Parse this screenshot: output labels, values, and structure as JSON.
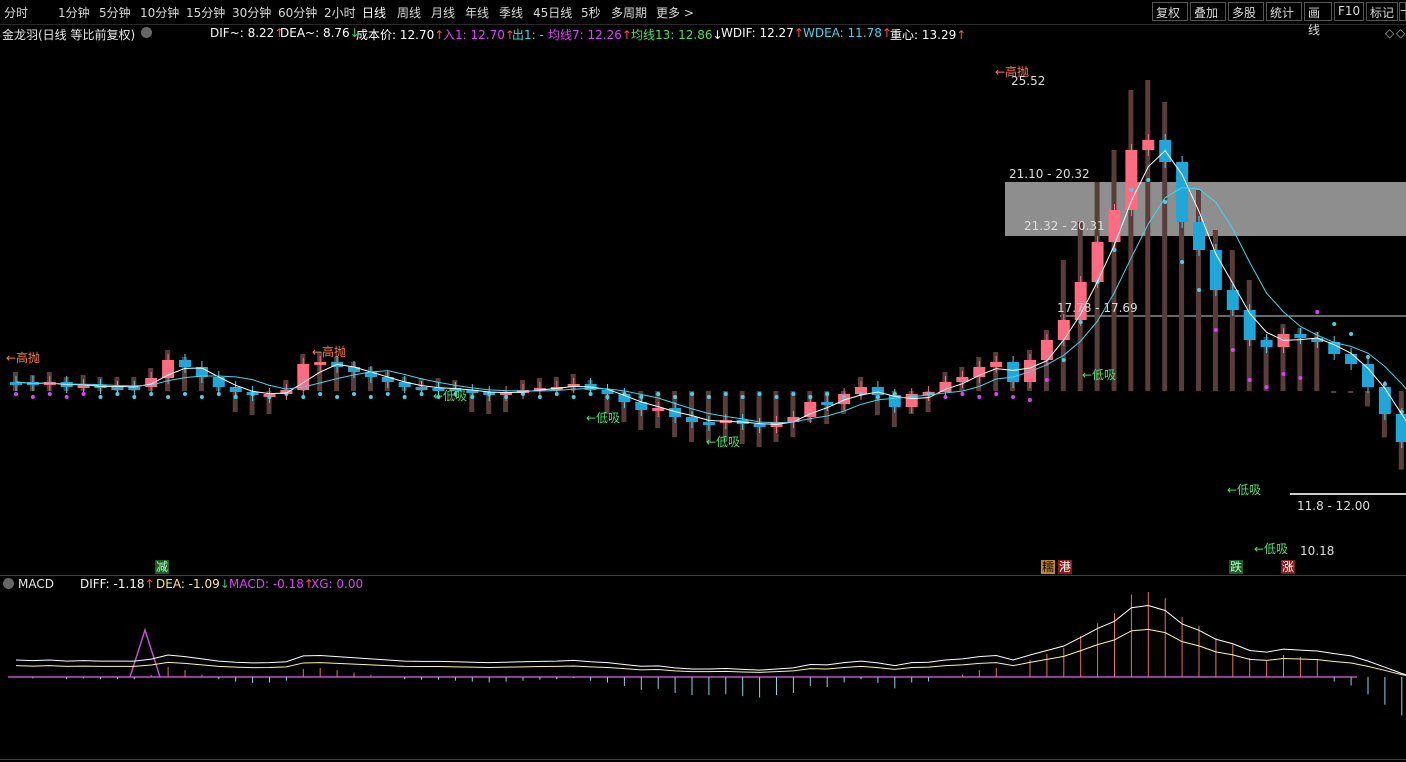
{
  "toolbar": {
    "periods": [
      "分时",
      "1分钟",
      "5分钟",
      "10分钟",
      "15分钟",
      "30分钟",
      "60分钟",
      "2小时",
      "日线",
      "周线",
      "月线",
      "年线",
      "季线",
      "45日线",
      "5秒",
      "多周期",
      "更多 >"
    ],
    "right_buttons": [
      "复权",
      "叠加",
      "多股",
      "统计",
      "画线",
      "F10",
      "标记",
      "—"
    ]
  },
  "info": {
    "stock": "金龙羽(日线 等比前复权)",
    "dif": "DIF~: 8.22",
    "dea": "DEA~: 8.76",
    "cost": "成本价: 12.70",
    "in": "入1: 12.70",
    "out": "出1: -",
    "ma7": "均线7: 12.26",
    "ma13": "均线13: 12.86",
    "wdif": "WDIF: 12.27",
    "wdea": "WDEA: 11.78",
    "center": "重心: 13.29",
    "colors": {
      "up": "#ff4d4d",
      "down": "#39d353",
      "magenta": "#e040fb",
      "green": "#48e06a",
      "cyan": "#3fd5e8"
    }
  },
  "annotations": {
    "high_sell": "←高抛",
    "low_buy": "←低吸",
    "peak_value": "25.52",
    "band1": "21.10 - 20.32",
    "band2": "21.32 - 20.31",
    "band3": "17.78 - 17.69",
    "band4": "11.8 - 12.00",
    "low_value": "10.18",
    "tags": [
      "减",
      "糯",
      "港",
      "跌",
      "涨"
    ]
  },
  "macd": {
    "title": "MACD",
    "diff": "DIFF: -1.18",
    "dea": "DEA: -1.09",
    "macd": "MACD: -0.18",
    "xg": "XG: 0.00"
  }
}
